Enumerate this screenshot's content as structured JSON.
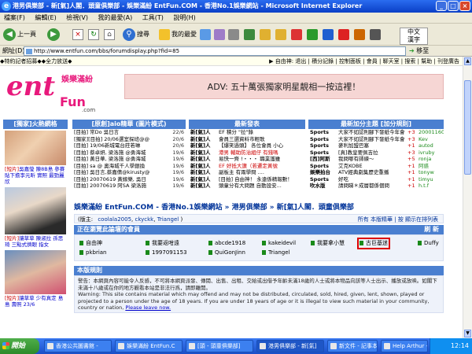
{
  "window": {
    "title": "港男俱樂部 - 新[氣]人閣．頭童俱樂部 - 娛樂滿紛 EntFun.COM - 香港No.1娛樂網站 - Microsoft Internet Explorer"
  },
  "menu": [
    "檔案(F)",
    "編輯(E)",
    "檢視(V)",
    "我的最愛(A)",
    "工具(T)",
    "說明(H)"
  ],
  "toolbar": {
    "back": "上一頁",
    "search": "搜尋",
    "favorites": "我的最愛"
  },
  "ime": {
    "label": "中文\n漢字"
  },
  "address": {
    "label": "網址(D)",
    "url": "http://www.entfun.com/bbs/forumdisplay.php?fid=85",
    "go": "移至"
  },
  "topstrip": {
    "left": "◆特約記者招募◆◆全力放送◆",
    "right": "▶ 自由神: 退出 | 積分記錄 | 控制面板 | 會員 | 聊天室 | 搜索 | 幫助 | 刊登廣告"
  },
  "logo": {
    "main": "ent",
    "sub": "Fun",
    "tld": ".com",
    "cjk": "娛樂滿紛"
  },
  "adv": "ADV: 五十萬張獨家明星靚相一按這裡！",
  "left": {
    "header": "[獨家]火熱網格",
    "items": [
      {
        "badge": "[短片]",
        "text": "吳嘉瑩 陳8B島 參賽貼下擔李元昕 實照 最勁麗欣"
      },
      {
        "badge": "[短片]",
        "text": "讓草草 陳淑拉 孫思琦 三點式擠眼 指女"
      },
      {
        "badge": "[短片]",
        "text": "讓草草 少有真定 島島 壽照 23/6"
      }
    ]
  },
  "sections": [
    {
      "title": "[原創]aio精華 (圖片模式)",
      "rows": [
        {
          "l": "[目拍] 常Do 吳日言",
          "r": "22/6"
        },
        {
          "l": "[獨家][目拍] 20/06選室探班@@",
          "r": "20/6"
        },
        {
          "l": "[目拍] 19/06新城電台莊若琳",
          "r": "20/6"
        },
        {
          "l": "[目拍] 蔡卓妍, 梁洛施 @勇海城",
          "r": "19/6"
        },
        {
          "l": "[目拍] 黃日華, 梁洛施 @勇海城",
          "r": "19/6"
        },
        {
          "l": "[目拍] sa @ 奧海城千人學銀換",
          "r": "19/6"
        },
        {
          "l": "[目拍] 吳日言,蔡嘉倩@kirusty@",
          "r": "19/6"
        },
        {
          "l": "[目拍] 20070619 黃嫁樂, 吳日",
          "r": "19/6"
        },
        {
          "l": "[目拍] 20070619 阿SA 梁洛施",
          "r": "19/6"
        }
      ]
    },
    {
      "title": "最新發表",
      "rows": [
        {
          "l": "新[氣]人",
          "r": "EF 積分 \"拉\"錄"
        },
        {
          "l": "新[氣]人",
          "r": "會員三選資料市輕歌"
        },
        {
          "l": "新[氣]人",
          "r": "【爆笑過頭】 各位會員 小心"
        },
        {
          "l": "新[氣]人",
          "r": "港男 輔助防治組仔 有錢嗎"
        },
        {
          "l": "新[氣]人",
          "r": "易快一齊 !・・・ 職業護雖"
        },
        {
          "l": "新[氣]人",
          "r": "EF 好抵大讚（若遷定黃號"
        },
        {
          "l": "新[氣]人",
          "r": "副板主 有兩學問 ...."
        },
        {
          "l": "新[氣]人",
          "r": "[目拍] 自由神！ 永遠係精報數！"
        },
        {
          "l": "新[氣]人",
          "r": "頭童分有大問題 自動設安..."
        }
      ]
    },
    {
      "title": "最新加分主題 [加分規則]",
      "rows": [
        {
          "l": "Sports",
          "r": "大家不如認則腳下發紙今年會",
          "s": "+3",
          "u": "20001160"
        },
        {
          "l": "Sports",
          "r": "大家不如認則腳下發紙今年會",
          "s": "+3",
          "u": "Kev"
        },
        {
          "l": "Sports",
          "r": "麥利加盟巴塞",
          "s": "+1",
          "u": "autod"
        },
        {
          "l": "Sports",
          "r": "[真]教皇要佩吉拉",
          "s": "+3",
          "u": "ivruby"
        },
        {
          "l": "[西]阿斯",
          "r": "我問哪有師練～",
          "s": "+5",
          "u": "ronja"
        },
        {
          "l": "Sports",
          "r": "艾克KOBE",
          "s": "+1",
          "u": "阿惑"
        },
        {
          "l": "娛樂拍台",
          "r": "ATV經典劇集歷史重播",
          "s": "+1",
          "u": "tonyw"
        },
        {
          "l": "Sports",
          "r": "好吃",
          "s": "+1",
          "u": "timyu"
        },
        {
          "l": "吹水版",
          "r": "請問睇＊成層都係個問",
          "s": "+1",
          "u": "h.t.f"
        }
      ]
    }
  ],
  "breadcrumb": "娛樂滿紛 EntFun.COM - 香港No.1娛樂網站 » 港男俱樂部 » 新[氣]人閣．頭童俱樂部",
  "moderators": {
    "label": "(版主:",
    "names": [
      "coolala2005",
      "ckyckk",
      "Triangel"
    ],
    "close": ")",
    "right": "所有 本版精華 | 按 顯示在排列表"
  },
  "online": {
    "header": "正在瀏覽此論壇的會員",
    "header_right": "刷 新",
    "users": [
      "自由神",
      "我要返咁遠",
      "abcde1918",
      "kakeidevil",
      "我要拿小慧",
      "古巨基迷",
      "Duffy",
      "pkbrian",
      "1997091153",
      "QuiGonJinn",
      "Triangel"
    ]
  },
  "rules": {
    "header": "本版規則",
    "text_zh": "警告：本網頁內容可能令人反感，不可將本網頁派發、傳閱、出售、出租、交給或出借予年齡未滿18歲的人士或將本物品向該等人士出示、播放或放映。如閣下未滿十八歲或在你的地方觀看本站是非法行爲，請即離開。",
    "text_en": "Warning: This site contains material which may offend and may not be distributed, circulated, sold, hired, given, lent, shown, played or projected to a person under the age of 18 years. If you are under 18 years of age or it is illegal to view such material in your community, country or nation,",
    "link": "Please leave now."
  },
  "taskbar": {
    "start": "開始",
    "tasks": [
      "香港公共圖書館 -",
      "娛樂滿紛 EntFun.C",
      "[頭 - 頭童俱樂部]",
      "港男俱樂部 - 新[氣]",
      "新文件 - 記事本",
      "Help Arthur - 對話"
    ],
    "clock": "12:14"
  }
}
